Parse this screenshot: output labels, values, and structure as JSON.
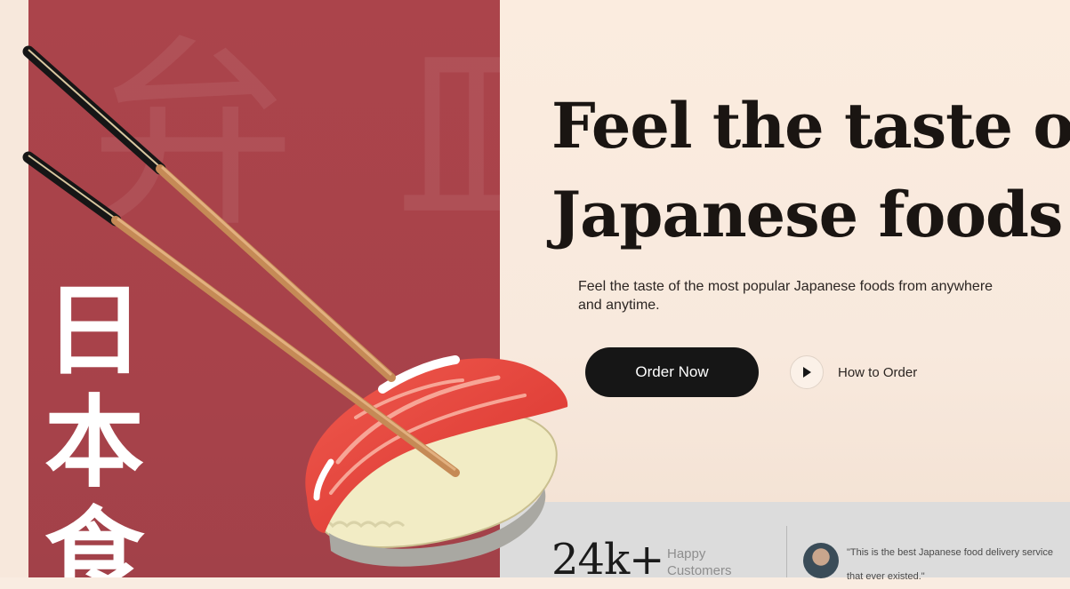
{
  "hero": {
    "background_kanji": "弁 皿",
    "vertical_kanji": [
      "日",
      "本",
      "食"
    ],
    "headline_line1": "Feel the taste of",
    "headline_line2": "Japanese foods",
    "subtext": "Feel the taste of the most popular Japanese foods from anywhere and anytime.",
    "order_button": "Order Now",
    "how_to_order": "How to Order"
  },
  "stats": {
    "customers_number": "24k+",
    "customers_label": "Happy Customers",
    "quote": "\"This is the best Japanese food delivery service that ever existed.\""
  },
  "colors": {
    "panel_red": "#a8434a",
    "cream": "#f9ece1",
    "dark": "#161616"
  },
  "icons": {
    "play": "play-icon",
    "chopsticks": "chopsticks-illustration",
    "sushi": "sushi-illustration"
  }
}
